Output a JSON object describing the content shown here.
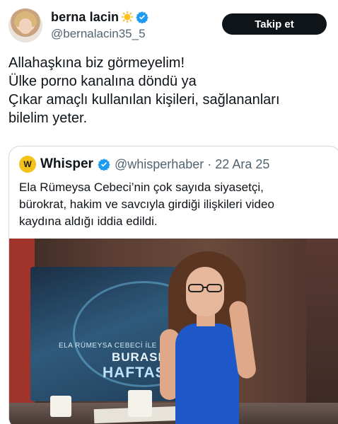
{
  "author": {
    "display_name": "berna lacin",
    "name_emoji": "sun-with-face-emoji",
    "verified": true,
    "handle": "@bernalacin35_5",
    "follow_label": "Takip et"
  },
  "tweet": {
    "lines": [
      "Allahaşkına biz görmeyelim!",
      "Ülke porno kanalına döndü ya",
      "Çıkar amaçlı kullanılan kişileri, sağlananları",
      "bilelim yeter."
    ]
  },
  "quote": {
    "logo_text": "W",
    "name": "Whisper",
    "verified": true,
    "handle_date": "@whisperhaber · 22 Ara 25",
    "lines": [
      "Ela Rümeysa Cebeci’nin çok sayıda siyasetçi,",
      "bürokrat, hakim ve savcıyla girdiği ilişkileri video",
      "kaydına aldığı iddia edildi."
    ],
    "media": {
      "screen_caption": "ELA RÜMEYSA CEBECİ İLE",
      "screen_title_1": "BURASI",
      "screen_title_2": "HAFTASI"
    }
  },
  "colors": {
    "text": "#0f1419",
    "secondary": "#536471",
    "verified_blue": "#1d9bf0",
    "border": "#cfd9de",
    "button_bg": "#0f1419"
  }
}
